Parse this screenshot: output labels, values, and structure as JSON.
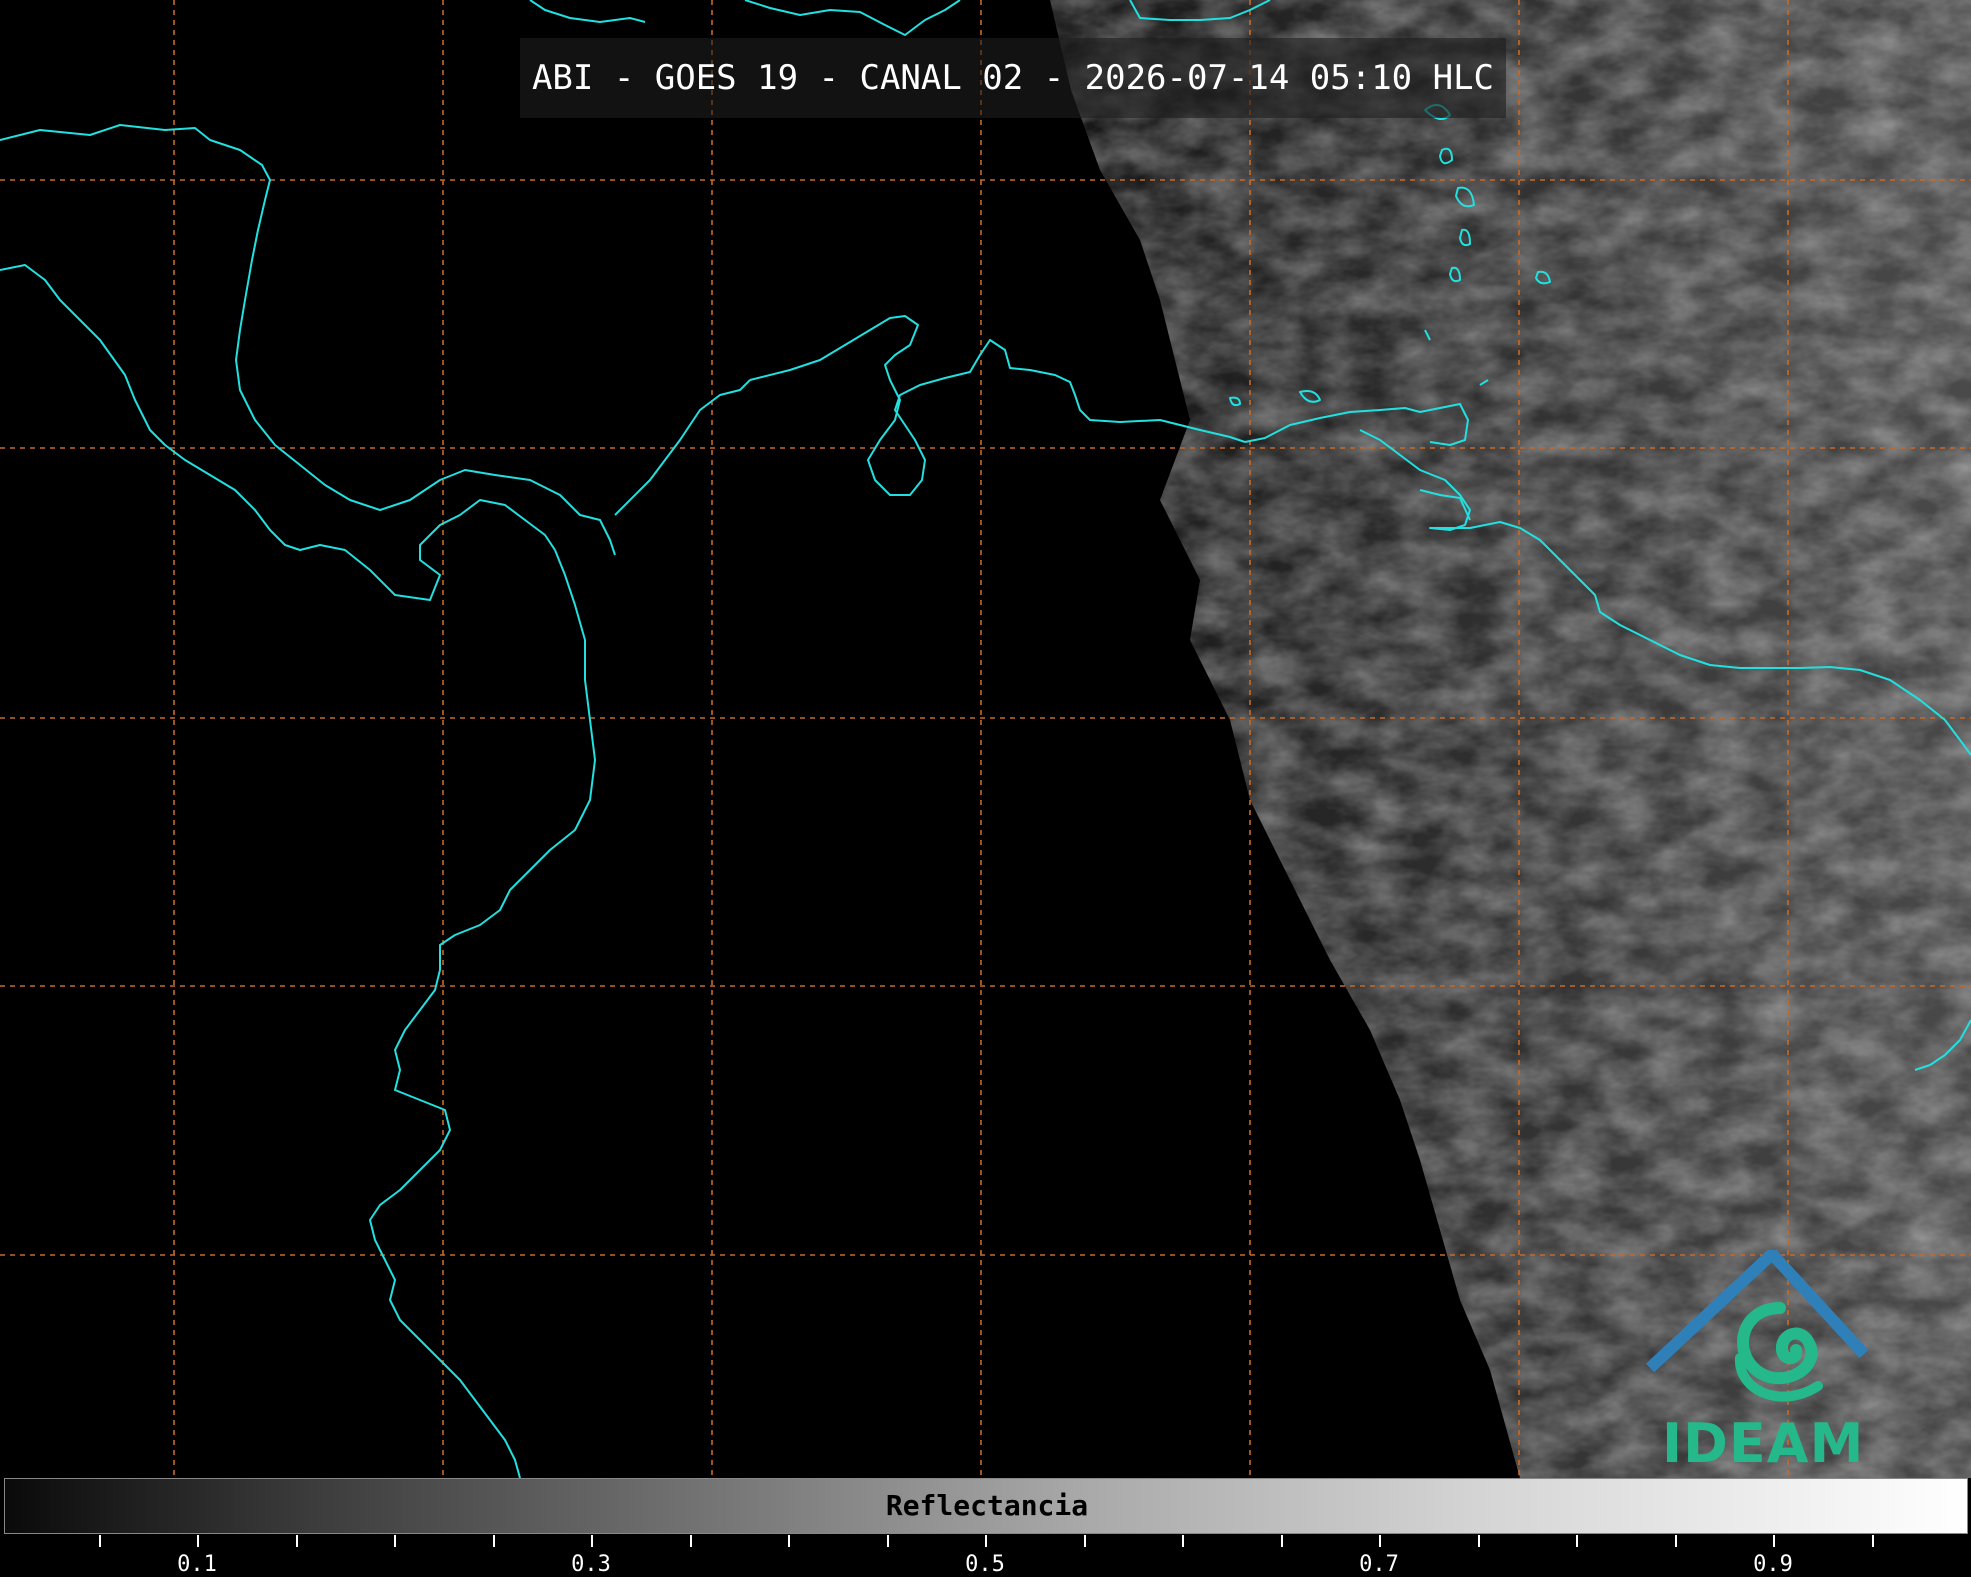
{
  "header": {
    "title": "ABI - GOES 19 - CANAL 02 - 2026-07-14 05:10 HLC"
  },
  "map": {
    "coastline_color": "#22e0e0",
    "grid_color": "#c46a2a",
    "night_color": "#000000",
    "day_color": "#4a4a4a"
  },
  "logo": {
    "text": "IDEAM",
    "roof_color": "#2f7fb8",
    "swirl_color": "#25b88a"
  },
  "colorbar": {
    "label": "Reflectancia",
    "tick_labels": [
      "0.1",
      "0.3",
      "0.5",
      "0.7",
      "0.9"
    ]
  }
}
